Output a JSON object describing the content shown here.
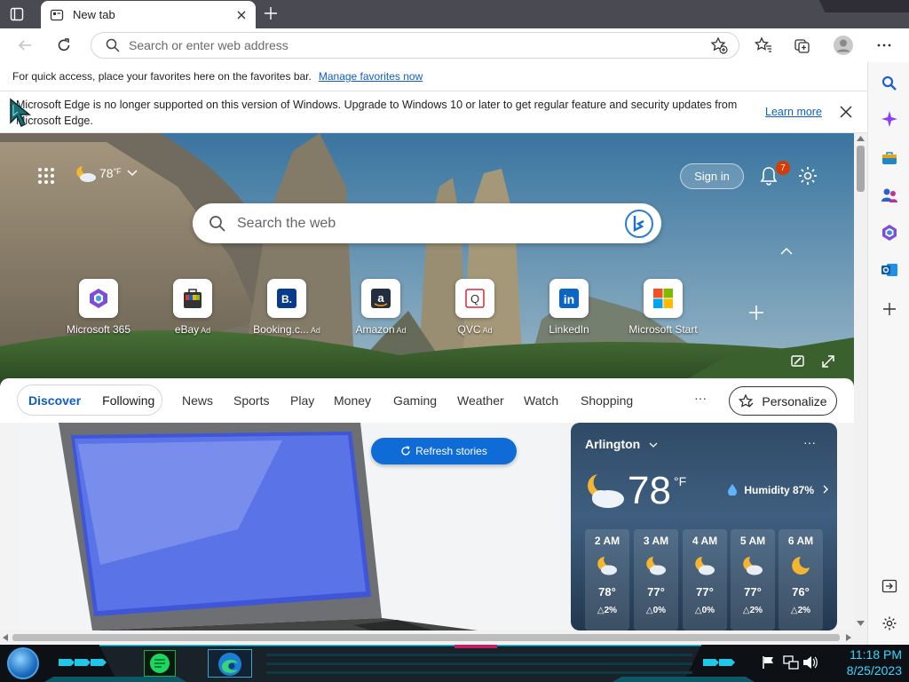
{
  "browser": {
    "tab_title": "New tab",
    "omnibox_placeholder": "Search or enter web address"
  },
  "favorites_bar": {
    "message": "For quick access, place your favorites here on the favorites bar.",
    "link": "Manage favorites now"
  },
  "infobar": {
    "message": "Microsoft Edge is no longer supported on this version of Windows. Upgrade to Windows 10 or later to get regular feature and security updates from Microsoft Edge.",
    "link": "Learn more"
  },
  "hero": {
    "weather_temp": "78",
    "weather_unit": "°F",
    "sign_in": "Sign in",
    "notification_count": "7",
    "search_placeholder": "Search the web",
    "ad_label": "Ad",
    "tiles": [
      {
        "label": "Microsoft 365",
        "ad": false,
        "icon": "microsoft-365-icon"
      },
      {
        "label": "eBay",
        "ad": true,
        "icon": "ebay-icon"
      },
      {
        "label": "Booking.c...",
        "ad": true,
        "icon": "booking-icon"
      },
      {
        "label": "Amazon",
        "ad": true,
        "icon": "amazon-icon"
      },
      {
        "label": "QVC",
        "ad": true,
        "icon": "qvc-icon"
      },
      {
        "label": "LinkedIn",
        "ad": false,
        "icon": "linkedin-icon"
      },
      {
        "label": "Microsoft Start",
        "ad": false,
        "icon": "microsoft-start-icon"
      }
    ],
    "booking_glyph": "B.",
    "qvc_glyph": "Q",
    "linkedin_glyph": "in",
    "amazon_glyph": "a"
  },
  "feed_nav": {
    "discover": "Discover",
    "following": "Following",
    "items": [
      "News",
      "Sports",
      "Play",
      "Money",
      "Gaming",
      "Weather",
      "Watch",
      "Shopping"
    ],
    "more": "···",
    "personalize": "Personalize"
  },
  "feed": {
    "refresh": "Refresh stories"
  },
  "weather_card": {
    "location": "Arlington",
    "more": "···",
    "temp": "78",
    "unit": "°F",
    "humidity": "Humidity 87%",
    "hours": [
      {
        "time": "2 AM",
        "temp": "78°",
        "precip": "2%",
        "icon": "partly-cloudy-night-icon"
      },
      {
        "time": "3 AM",
        "temp": "77°",
        "precip": "0%",
        "icon": "partly-cloudy-night-icon"
      },
      {
        "time": "4 AM",
        "temp": "77°",
        "precip": "0%",
        "icon": "partly-cloudy-night-icon"
      },
      {
        "time": "5 AM",
        "temp": "77°",
        "precip": "2%",
        "icon": "partly-cloudy-night-icon"
      },
      {
        "time": "6 AM",
        "temp": "76°",
        "precip": "2%",
        "icon": "moon-icon"
      }
    ]
  },
  "taskbar": {
    "time": "11:18 PM",
    "date": "8/25/2023"
  },
  "colors": {
    "accent": "#0f6cd6",
    "link": "#0f5ec7",
    "tray_text": "#38d7ff"
  }
}
